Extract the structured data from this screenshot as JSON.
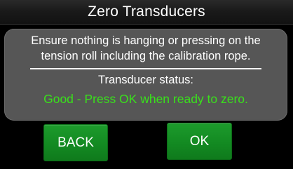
{
  "dialog": {
    "title": "Zero Transducers",
    "instruction_line1": "Ensure nothing is hanging or pressing on the",
    "instruction_line2": "tension roll including the calibration rope.",
    "status_label": "Transducer status:",
    "status_value": "Good - Press OK when ready to zero.",
    "status_color": "#39e11b"
  },
  "buttons": {
    "back_label": "BACK",
    "ok_label": "OK",
    "color": "#138a22"
  }
}
